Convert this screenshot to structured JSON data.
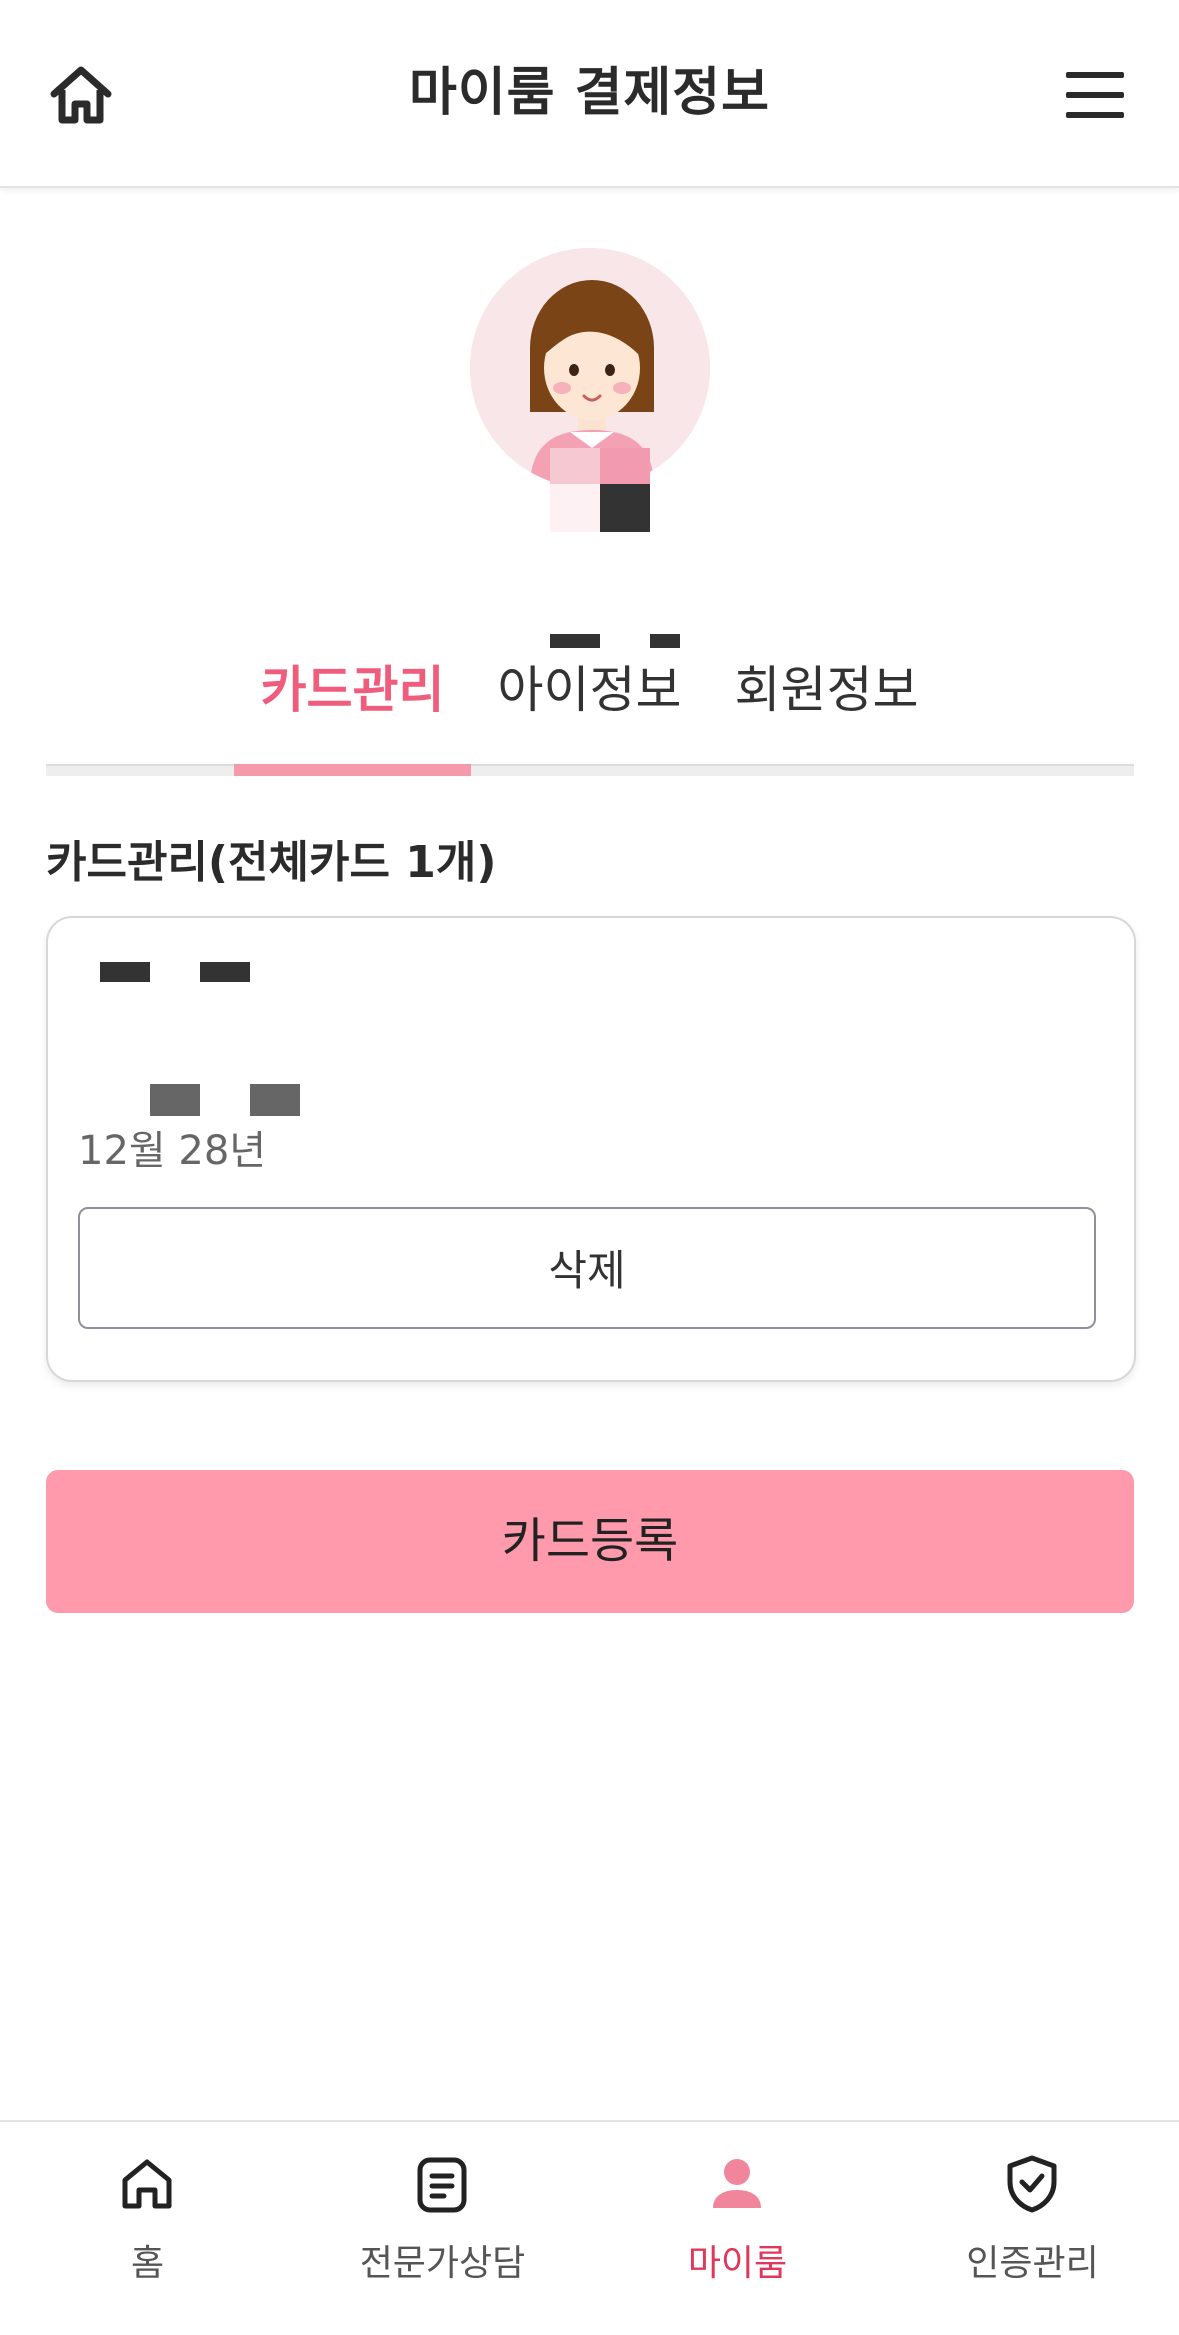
{
  "header": {
    "title": "마이룸 결제정보",
    "home_icon": "home-icon",
    "menu_icon": "hamburger-menu-icon"
  },
  "profile": {
    "avatar_icon": "girl-avatar-icon"
  },
  "tabs": [
    {
      "label": "카드관리",
      "active": true
    },
    {
      "label": "아이정보",
      "active": false
    },
    {
      "label": "회원정보",
      "active": false
    }
  ],
  "card_section": {
    "title": "카드관리(전체카드 1개)",
    "card": {
      "expiry_text": "12월 28년",
      "delete_label": "삭제"
    }
  },
  "register_button": {
    "label": "카드등록"
  },
  "bottom_nav": [
    {
      "label": "홈",
      "icon": "home-icon",
      "active": false
    },
    {
      "label": "전문가상담",
      "icon": "document-icon",
      "active": false
    },
    {
      "label": "마이룸",
      "icon": "person-icon",
      "active": true
    },
    {
      "label": "인증관리",
      "icon": "shield-check-icon",
      "active": false
    }
  ],
  "colors": {
    "accent": "#ef5c7c",
    "register_bg": "#fe9aab",
    "nav_active": "#e0385b"
  }
}
